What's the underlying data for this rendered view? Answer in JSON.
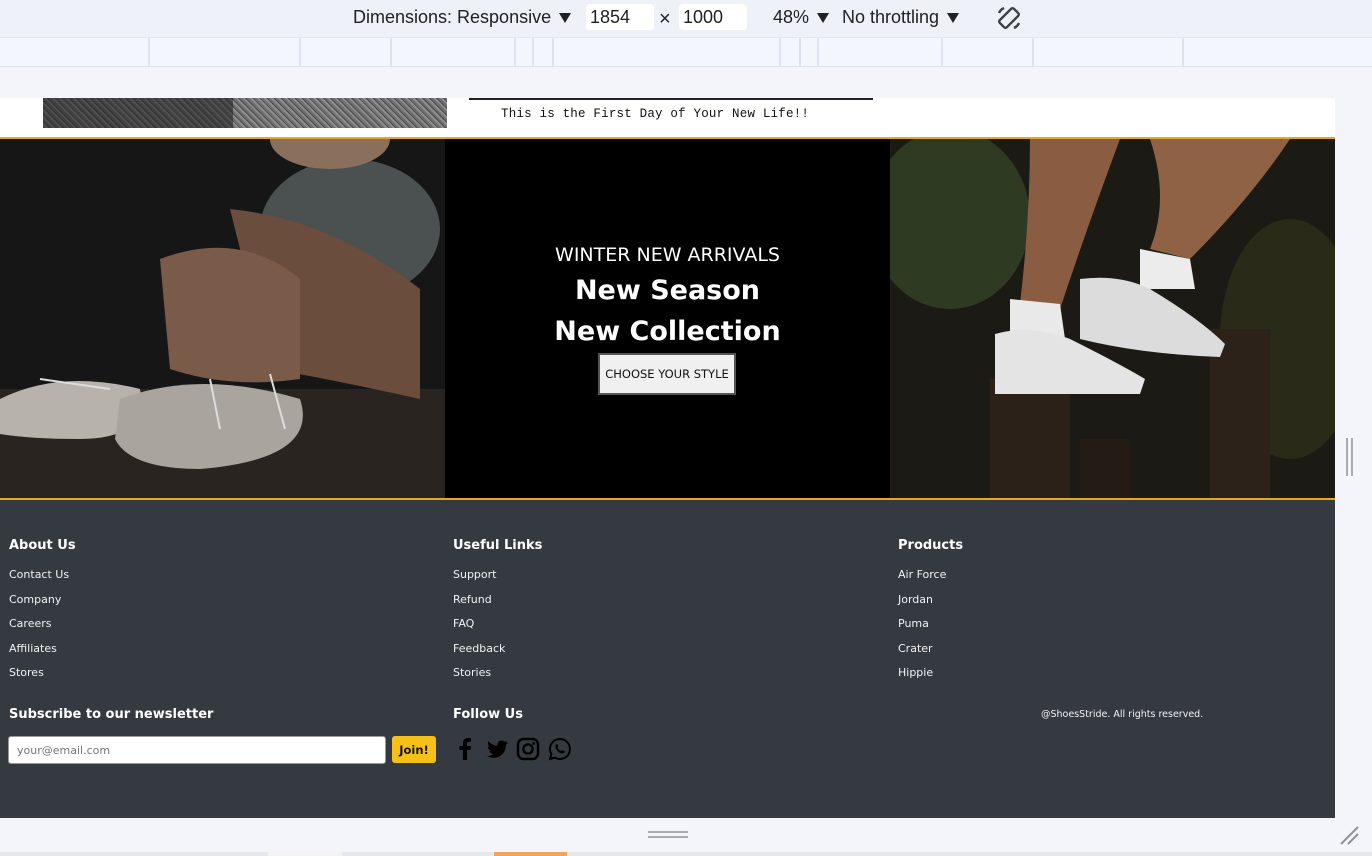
{
  "devtools": {
    "dimensions_label": "Dimensions: Responsive",
    "width_value": "1854",
    "times": "×",
    "height_value": "1000",
    "zoom": "48%",
    "throttling": "No throttling"
  },
  "hero": {
    "tagline": "This is the First Day of Your New Life!!"
  },
  "banner": {
    "subtitle": "WINTER NEW ARRIVALS",
    "title_line1": "New Season",
    "title_line2": "New Collection",
    "cta": "CHOOSE YOUR STYLE"
  },
  "footer": {
    "columns": [
      {
        "heading": "About Us",
        "links": [
          "Contact Us",
          "Company",
          "Careers",
          "Affiliates",
          "Stores"
        ]
      },
      {
        "heading": "Useful Links",
        "links": [
          "Support",
          "Refund",
          "FAQ",
          "Feedback",
          "Stories"
        ]
      },
      {
        "heading": "Products",
        "links": [
          "Air Force",
          "Jordan",
          "Puma",
          "Crater",
          "Hippie"
        ]
      }
    ],
    "newsletter_title": "Subscribe to our newsletter",
    "email_placeholder": "your@email.com",
    "join_label": "Join!",
    "follow_title": "Follow Us",
    "social_icons": [
      "facebook-icon",
      "twitter-icon",
      "instagram-icon",
      "whatsapp-icon"
    ],
    "copyright": "@ShoesStride. All rights reserved."
  },
  "colors": {
    "accent": "#e3a72b",
    "footer_bg": "#343a40",
    "join_button": "#f5c116"
  }
}
